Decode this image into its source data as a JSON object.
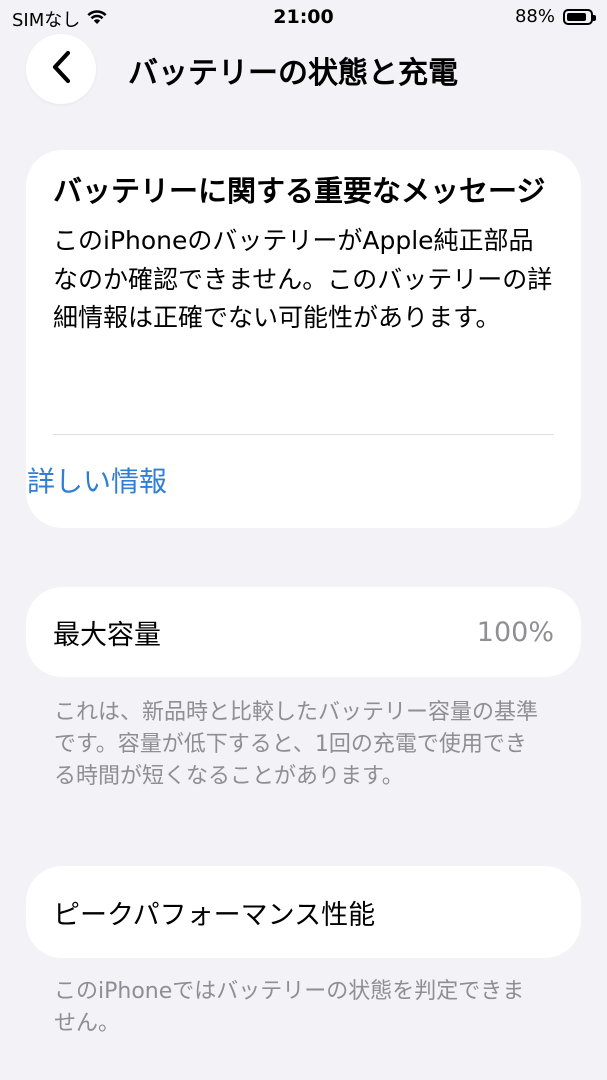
{
  "status_bar": {
    "carrier": "SIMなし",
    "time": "21:00",
    "battery_percent": "88%",
    "battery_level": 0.88
  },
  "nav": {
    "title": "バッテリーの状態と充電"
  },
  "message_card": {
    "title": "バッテリーに関する重要なメッセージ",
    "body": "このiPhoneのバッテリーがApple純正部品なのか確認できません。このバッテリーの詳細情報は正確でない可能性があります。",
    "link": "詳しい情報"
  },
  "capacity": {
    "label": "最大容量",
    "value": "100%",
    "footnote": "これは、新品時と比較したバッテリー容量の基準です。容量が低下すると、1回の充電で使用できる時間が短くなることがあります。"
  },
  "performance": {
    "label": "ピークパフォーマンス性能",
    "footnote": "このiPhoneではバッテリーの状態を判定できません。"
  },
  "colors": {
    "link": "#2f7fd6",
    "background": "#f2f2f7",
    "secondary_text": "#8e8e93"
  }
}
